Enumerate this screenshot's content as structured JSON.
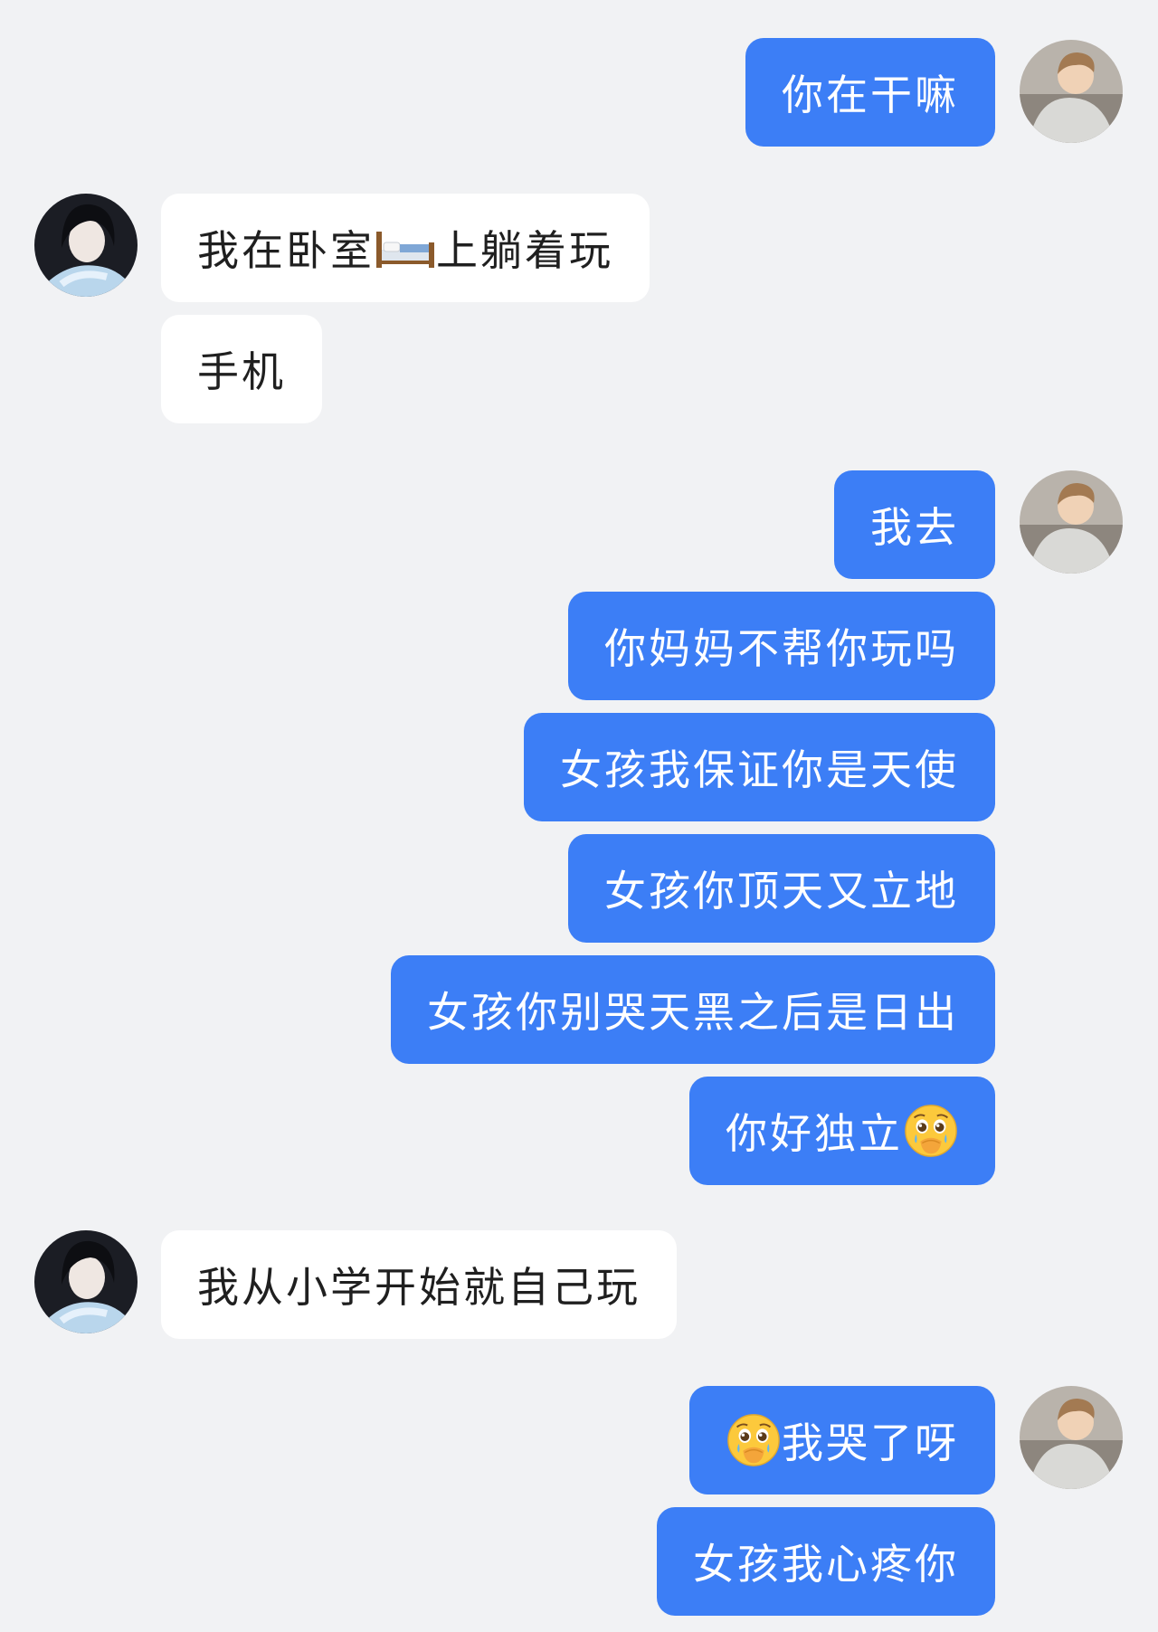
{
  "conversation": {
    "sender_avatar": {
      "icon": "boy-portrait-avatar-icon"
    },
    "receiver_avatar": {
      "icon": "girl-portrait-avatar-icon"
    },
    "colors": {
      "sent_bubble": "#3c7ef6",
      "received_bubble": "#ffffff",
      "background": "#f1f2f4"
    },
    "messages": [
      {
        "side": "sent",
        "text": "你在干嘛"
      },
      {
        "side": "received",
        "text_before_emoji": "我在卧室",
        "emoji": "bed-icon",
        "text_after_emoji": "上躺着玩"
      },
      {
        "side": "received",
        "text": "手机"
      },
      {
        "side": "sent",
        "text": "我去"
      },
      {
        "side": "sent",
        "text": "你妈妈不帮你玩吗"
      },
      {
        "side": "sent",
        "text": "女孩我保证你是天使"
      },
      {
        "side": "sent",
        "text": "女孩你顶天又立地"
      },
      {
        "side": "sent",
        "text": "女孩你别哭天黑之后是日出"
      },
      {
        "side": "sent",
        "text": "你好独立",
        "emoji": "holding-back-tears-face-icon"
      },
      {
        "side": "received",
        "text": "我从小学开始就自己玩"
      },
      {
        "side": "sent",
        "emoji": "holding-back-tears-face-icon",
        "text": "我哭了呀"
      },
      {
        "side": "sent",
        "text": "女孩我心疼你"
      }
    ]
  }
}
